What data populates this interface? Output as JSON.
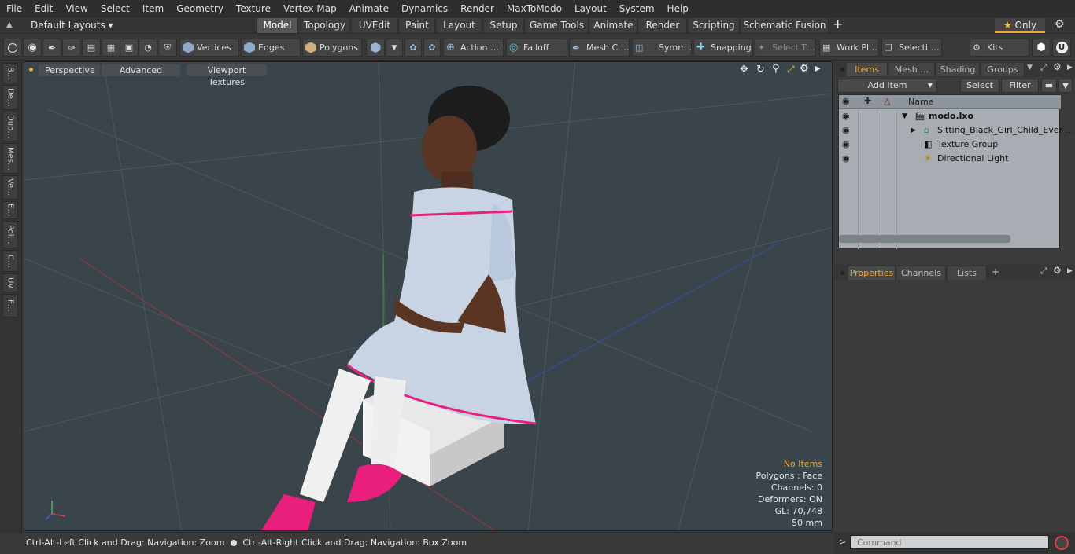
{
  "menu": [
    "File",
    "Edit",
    "View",
    "Select",
    "Item",
    "Geometry",
    "Texture",
    "Vertex Map",
    "Animate",
    "Dynamics",
    "Render",
    "MaxToModo",
    "Layout",
    "System",
    "Help"
  ],
  "layouts": {
    "label": "Default Layouts ▾",
    "only": "Only",
    "tabs": [
      "Model",
      "Topology",
      "UVEdit",
      "Paint",
      "Layout",
      "Setup",
      "Game Tools",
      "Animate",
      "Render",
      "Scripting",
      "Schematic Fusion"
    ],
    "add": "+"
  },
  "toolbar": {
    "vertices": "Vertices",
    "edges": "Edges",
    "polygons": "Polygons",
    "action": "Action",
    "falloff": "Falloff",
    "mesh": "Mesh C …",
    "symm": "Symm …",
    "snapping": "Snapping",
    "select_t": "Select T…",
    "work_plane": "Work Pl…",
    "selecti": "Selecti …",
    "kits": "Kits"
  },
  "left_tabs": [
    "B…",
    "De…",
    "Dup…",
    "Mes…",
    "Ve…",
    "E…",
    "Pol…",
    "C…",
    "UV",
    "F…"
  ],
  "viewport": {
    "perspective": "Perspective",
    "advanced": "Advanced",
    "textures": "Viewport Textures",
    "info": [
      "No Items",
      "Polygons : Face",
      "Channels: 0",
      "Deformers: ON",
      "GL: 70,748",
      "50 mm"
    ],
    "accent": "#f0a838"
  },
  "status": {
    "hint1": "Ctrl-Alt-Left Click and Drag: Navigation: Zoom",
    "hint2": "Ctrl-Alt-Right Click and Drag: Navigation: Box Zoom"
  },
  "panel": {
    "tabs": [
      "Items",
      "Mesh …",
      "Shading",
      "Groups"
    ],
    "add_item": "Add Item",
    "select": "Select",
    "filter": "Filter",
    "col_name": "Name",
    "items": [
      "modo.lxo",
      "Sitting_Black_Girl_Child_Ever …",
      "Texture Group",
      "Directional Light"
    ],
    "prop_tabs": [
      "Properties",
      "Channels",
      "Lists"
    ],
    "prop_add": "+",
    "command": "Command"
  }
}
